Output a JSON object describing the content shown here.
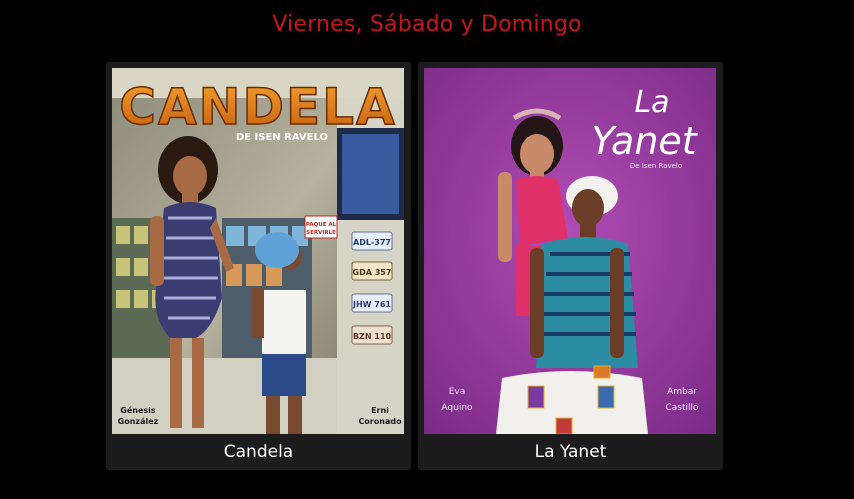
{
  "section": {
    "heading": "Viernes, Sábado y Domingo"
  },
  "cards": [
    {
      "title": "Candela",
      "poster": {
        "logo": "CANDELA",
        "byline": "DE ISEN RAVELO",
        "cast": [
          {
            "first": "Génesis",
            "last": "González"
          },
          {
            "first": "Erni",
            "last": "Coronado"
          }
        ],
        "plates": [
          "ADL-377",
          "GDA 357",
          "JHW 761",
          "BZN 110"
        ],
        "sign": [
          "PAQUE AL",
          "SERVIRLE"
        ]
      }
    },
    {
      "title": "La Yanet",
      "poster": {
        "logo_line1": "La",
        "logo_line2": "Yanet",
        "byline": "De Isen Ravelo",
        "cast": [
          {
            "first": "Eva",
            "last": "Aquino"
          },
          {
            "first": "Ambar",
            "last": "Castillo"
          }
        ]
      }
    }
  ],
  "colors": {
    "heading": "#c8151b",
    "card_bg": "#1c1c1c",
    "page_bg": "#000000",
    "candela_logo": "#e07a16",
    "yanet_bg": "#9a3aa0"
  }
}
